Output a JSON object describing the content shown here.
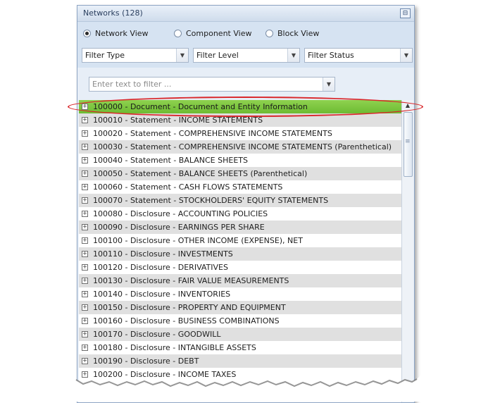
{
  "panel": {
    "title": "Networks (128)",
    "pin_icon": "pin-icon"
  },
  "views": [
    {
      "label": "Network View",
      "selected": true
    },
    {
      "label": "Component View",
      "selected": false
    },
    {
      "label": "Block View",
      "selected": false
    }
  ],
  "filters": {
    "type": "Filter Type",
    "level": "Filter Level",
    "status": "Filter Status",
    "search_placeholder": "Enter text to filter ..."
  },
  "rows": [
    "100000 - Document - Document and Entity Information",
    "100010 - Statement - INCOME STATEMENTS",
    "100020 - Statement - COMPREHENSIVE INCOME STATEMENTS",
    "100030 - Statement - COMPREHENSIVE INCOME STATEMENTS (Parenthetical)",
    "100040 - Statement - BALANCE SHEETS",
    "100050 - Statement - BALANCE SHEETS (Parenthetical)",
    "100060 - Statement - CASH FLOWS STATEMENTS",
    "100070 - Statement - STOCKHOLDERS' EQUITY STATEMENTS",
    "100080 - Disclosure - ACCOUNTING POLICIES",
    "100090 - Disclosure - EARNINGS PER SHARE",
    "100100 - Disclosure - OTHER INCOME (EXPENSE), NET",
    "100110 - Disclosure - INVESTMENTS",
    "100120 - Disclosure - DERIVATIVES",
    "100130 - Disclosure - FAIR VALUE MEASUREMENTS",
    "100140 - Disclosure - INVENTORIES",
    "100150 - Disclosure - PROPERTY AND EQUIPMENT",
    "100160 - Disclosure - BUSINESS COMBINATIONS",
    "100170 - Disclosure - GOODWILL",
    "100180 - Disclosure - INTANGIBLE ASSETS",
    "100190 - Disclosure - DEBT",
    "100200 - Disclosure - INCOME TAXES"
  ],
  "selected_row": 0,
  "colors": {
    "selected_row": "#7cc540",
    "highlight_oval": "#d9262a",
    "panel_bg": "#d6e3f2"
  }
}
